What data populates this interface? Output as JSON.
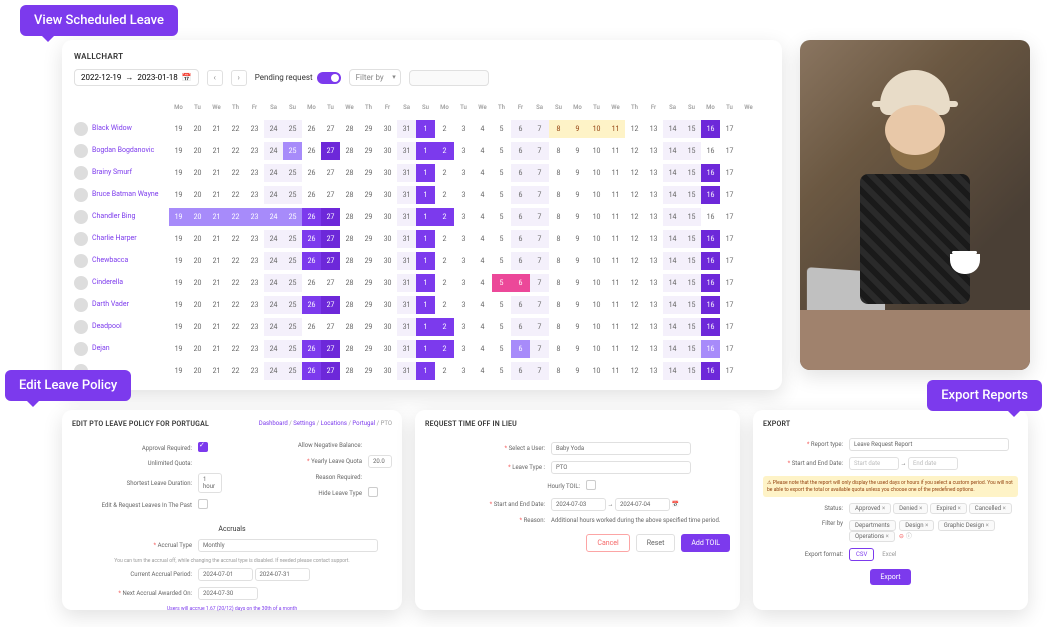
{
  "tags": {
    "view": "View Scheduled Leave",
    "edit": "Edit Leave Policy",
    "export": "Export Reports"
  },
  "wallchart": {
    "title": "WALLCHART",
    "date_from": "2022-12-19",
    "date_to": "2023-01-18",
    "pending_label": "Pending request",
    "filter_label": "Filter by",
    "dow": [
      "Mo",
      "Tu",
      "We",
      "Th",
      "Fr",
      "Sa",
      "Su",
      "Mo",
      "Tu",
      "We",
      "Th",
      "Fr",
      "Sa",
      "Su",
      "Mo",
      "Tu",
      "We",
      "Th",
      "Fr",
      "Sa",
      "Su",
      "Mo",
      "Tu",
      "We",
      "Th",
      "Fr",
      "Sa",
      "Su",
      "Mo",
      "Tu",
      "We"
    ],
    "days": [
      "19",
      "20",
      "21",
      "22",
      "23",
      "24",
      "25",
      "26",
      "27",
      "28",
      "29",
      "30",
      "31",
      "1",
      "2",
      "3",
      "4",
      "5",
      "6",
      "7",
      "8",
      "9",
      "10",
      "11",
      "12",
      "13",
      "14",
      "15",
      "16",
      "17"
    ],
    "people": [
      {
        "name": "Black Widow",
        "cells": [
          "",
          "",
          "",
          "",
          "",
          "wk",
          "wk",
          "",
          "",
          "",
          "",
          "",
          "wk",
          "lv2",
          "",
          "",
          "",
          "",
          "wk",
          "wk",
          "hy",
          "hy",
          "hy",
          "hy",
          "",
          "",
          "wk",
          "wk",
          "lv3",
          ""
        ]
      },
      {
        "name": "Bogdan Bogdanovic",
        "cells": [
          "",
          "",
          "",
          "",
          "",
          "wk",
          "lv1",
          "",
          "lv3",
          "",
          "",
          "",
          "wk",
          "lv2",
          "lv2",
          "",
          "",
          "",
          "wk",
          "wk",
          "",
          "",
          "",
          "",
          "",
          "",
          "wk",
          "wk",
          "",
          ""
        ]
      },
      {
        "name": "Brainy Smurf",
        "cells": [
          "",
          "",
          "",
          "",
          "",
          "wk",
          "wk",
          "",
          "",
          "",
          "",
          "",
          "wk",
          "lv2",
          "",
          "",
          "",
          "",
          "wk",
          "wk",
          "",
          "",
          "",
          "",
          "",
          "",
          "wk",
          "wk",
          "lv3",
          ""
        ]
      },
      {
        "name": "Bruce Batman Wayne",
        "cells": [
          "",
          "",
          "",
          "",
          "",
          "wk",
          "wk",
          "",
          "",
          "",
          "",
          "",
          "wk",
          "lv2",
          "",
          "",
          "",
          "",
          "wk",
          "wk",
          "",
          "",
          "",
          "",
          "",
          "",
          "wk",
          "wk",
          "lv3",
          ""
        ]
      },
      {
        "name": "Chandler Bing",
        "cells": [
          "lv1",
          "lv1",
          "lv1",
          "lv1",
          "lv1",
          "lv1",
          "lv1",
          "lv2",
          "lv3",
          "",
          "",
          "",
          "wk",
          "lv2",
          "lv2",
          "",
          "",
          "",
          "wk",
          "wk",
          "",
          "",
          "",
          "",
          "",
          "",
          "wk",
          "wk",
          "",
          ""
        ]
      },
      {
        "name": "Charlie Harper",
        "cells": [
          "",
          "",
          "",
          "",
          "",
          "wk",
          "wk",
          "lv2",
          "lv3",
          "",
          "",
          "",
          "wk",
          "lv2",
          "",
          "",
          "",
          "",
          "wk",
          "wk",
          "",
          "",
          "",
          "",
          "",
          "",
          "wk",
          "wk",
          "lv3",
          ""
        ]
      },
      {
        "name": "Chewbacca",
        "cells": [
          "",
          "",
          "",
          "",
          "",
          "wk",
          "wk",
          "lv2",
          "lv3",
          "",
          "",
          "",
          "wk",
          "lv2",
          "",
          "",
          "",
          "",
          "wk",
          "wk",
          "",
          "",
          "",
          "",
          "",
          "",
          "wk",
          "wk",
          "lv3",
          ""
        ]
      },
      {
        "name": "Cinderella",
        "cells": [
          "",
          "",
          "",
          "",
          "",
          "wk",
          "wk",
          "",
          "",
          "",
          "",
          "",
          "wk",
          "lv2",
          "",
          "",
          "",
          "hp",
          "hp",
          "wk",
          "",
          "",
          "",
          "",
          "",
          "",
          "wk",
          "wk",
          "lv3",
          ""
        ]
      },
      {
        "name": "Darth Vader",
        "cells": [
          "",
          "",
          "",
          "",
          "",
          "wk",
          "wk",
          "lv2",
          "lv3",
          "",
          "",
          "",
          "wk",
          "lv2",
          "",
          "",
          "",
          "",
          "wk",
          "wk",
          "",
          "",
          "",
          "",
          "",
          "",
          "wk",
          "wk",
          "lv3",
          ""
        ]
      },
      {
        "name": "Deadpool",
        "cells": [
          "",
          "",
          "",
          "",
          "",
          "wk",
          "wk",
          "",
          "",
          "",
          "",
          "",
          "wk",
          "lv2",
          "lv2",
          "",
          "",
          "",
          "wk",
          "wk",
          "",
          "",
          "",
          "",
          "",
          "",
          "wk",
          "wk",
          "lv3",
          ""
        ]
      },
      {
        "name": "Dejan",
        "cells": [
          "",
          "",
          "",
          "",
          "",
          "wk",
          "wk",
          "lv2",
          "lv3",
          "",
          "",
          "",
          "wk",
          "lv2",
          "lv2",
          "",
          "",
          "",
          "lv1",
          "wk",
          "",
          "",
          "",
          "",
          "",
          "",
          "wk",
          "wk",
          "lv1",
          ""
        ]
      },
      {
        "name": "",
        "cells": [
          "",
          "",
          "",
          "",
          "",
          "wk",
          "wk",
          "lv2",
          "lv3",
          "",
          "",
          "",
          "wk",
          "lv2",
          "",
          "",
          "",
          "",
          "wk",
          "wk",
          "",
          "",
          "",
          "",
          "",
          "",
          "wk",
          "wk",
          "lv3",
          ""
        ]
      }
    ]
  },
  "edit_policy": {
    "title": "EDIT PTO LEAVE POLICY FOR PORTUGAL",
    "crumbs": [
      "Dashboard",
      "Settings",
      "Locations",
      "Portugal",
      "PTO"
    ],
    "approval": "Approval Required:",
    "neg_balance": "Allow Negative Balance:",
    "quota": "Unlimited Quota:",
    "yearly": "Yearly Leave Quota",
    "yearly_val": "20.0",
    "shortest": "Shortest Leave Duration:",
    "shortest_val": "1 hour",
    "reason": "Reason Required:",
    "edit_past": "Edit & Request Leaves In The Past",
    "hide": "Hide Leave Type",
    "accruals": "Accruals",
    "accrual_type": "Accrual Type",
    "accrual_type_val": "Monthly",
    "accrual_note": "You can turn the accrual off, while changing the accrual type is disabled. If needed please contact support.",
    "current": "Current Accrual Period:",
    "current_from": "2024-07-01",
    "current_to": "2024-07-31",
    "next": "Next Accrual Awarded On:",
    "next_val": "2024-07-30",
    "footer": "Users will accrue 1.67 (20/12) days on the 30th of a month"
  },
  "toil": {
    "title": "REQUEST TIME OFF IN LIEU",
    "user": "Select a User:",
    "user_val": "Baby Yoda",
    "type": "Leave Type :",
    "type_val": "PTO",
    "hourly": "Hourly TOIL:",
    "dates": "Start and End Date:",
    "date_from": "2024-07-03",
    "date_to": "2024-07-04",
    "reason": "Reason:",
    "reason_val": "Additional hours worked during the above specified time period.",
    "cancel": "Cancel",
    "reset": "Reset",
    "add": "Add TOIL"
  },
  "export": {
    "title": "EXPORT",
    "report_type": "Report type:",
    "report_type_val": "Leave Request Report",
    "dates": "Start and End Date:",
    "date_from": "Start date",
    "date_to": "End date",
    "alert": "⚠ Please note that the report will only display the used days or hours if you select a custom period. You will not be able to export the total or available quota unless you choose one of the predefined options.",
    "status": "Status:",
    "status_vals": [
      "Approved",
      "Denied",
      "Expired",
      "Cancelled"
    ],
    "filter": "Filter by",
    "filter_dept": "Departments",
    "filter_vals": [
      "Design",
      "Graphic Design",
      "Operations"
    ],
    "format": "Export format:",
    "csv": "CSV",
    "excel": "Excel",
    "btn": "Export"
  }
}
